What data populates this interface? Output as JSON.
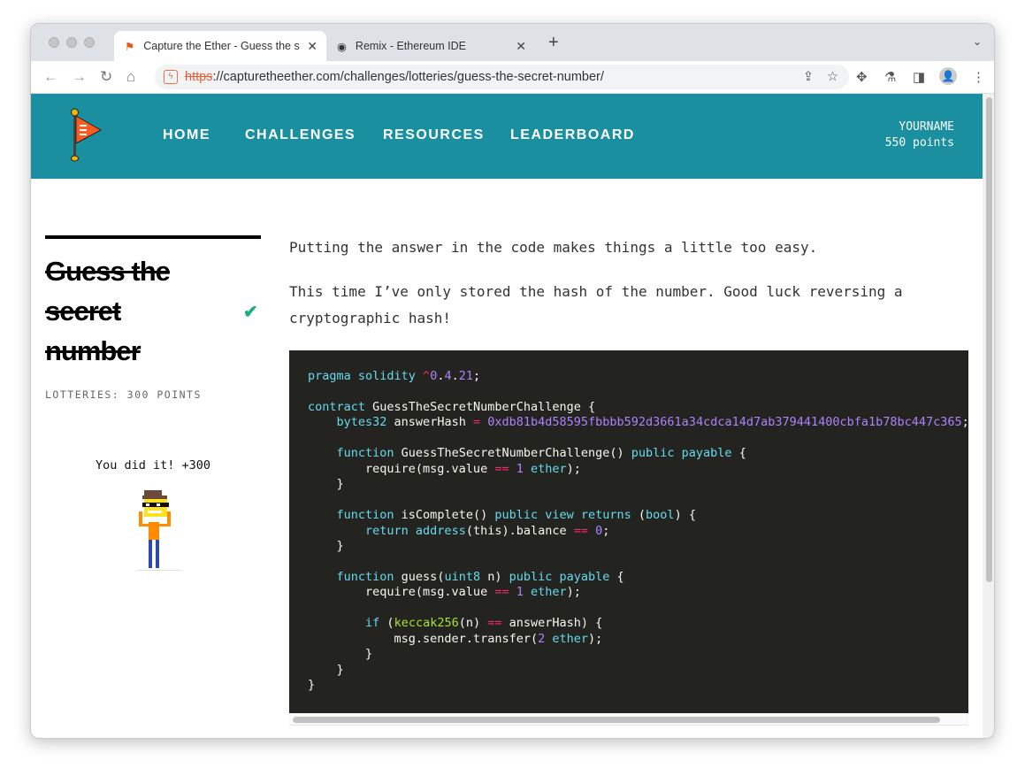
{
  "browser": {
    "tabs": [
      {
        "title": "Capture the Ether - Guess the s"
      },
      {
        "title": "Remix - Ethereum IDE"
      }
    ],
    "url_scheme": "https",
    "url_rest": "://capturetheether.com/challenges/lotteries/guess-the-secret-number/"
  },
  "header": {
    "menu": [
      "HOME",
      "CHALLENGES",
      "RESOURCES",
      "LEADERBOARD"
    ],
    "username": "YOURNAME",
    "points": "550 points"
  },
  "challenge": {
    "title": "Guess the secret number",
    "category": "LOTTERIES: 300 POINTS",
    "success": "You did it! +300"
  },
  "description": [
    "Putting the answer in the code makes things a little too easy.",
    "This time I’ve only stored the hash of the number. Good luck reversing a cryptographic hash!"
  ],
  "code": [
    [
      [
        "k",
        "pragma solidity "
      ],
      [
        "o",
        "^"
      ],
      [
        "n",
        "0"
      ],
      [
        "",
        "."
      ],
      [
        "n",
        "4"
      ],
      [
        "",
        "."
      ],
      [
        "n",
        "21"
      ],
      [
        "",
        ";"
      ]
    ],
    [],
    [
      [
        "k",
        "contract"
      ],
      [
        "",
        " GuessTheSecretNumberChallenge {"
      ]
    ],
    [
      [
        "",
        "    "
      ],
      [
        "k",
        "bytes32"
      ],
      [
        "",
        " answerHash "
      ],
      [
        "o",
        "="
      ],
      [
        "n",
        " 0xdb81b4d58595fbbbb592d3661a34cdca14d7ab379441400cbfa1b78bc447c365"
      ],
      [
        "",
        ";"
      ]
    ],
    [],
    [
      [
        "",
        "    "
      ],
      [
        "k",
        "function"
      ],
      [
        "",
        " GuessTheSecretNumberChallenge() "
      ],
      [
        "k",
        "public payable"
      ],
      [
        "",
        " {"
      ]
    ],
    [
      [
        "",
        "        require(msg.value "
      ],
      [
        "o",
        "=="
      ],
      [
        "n",
        " 1"
      ],
      [
        "k",
        " ether"
      ],
      [
        "",
        ");"
      ]
    ],
    [
      [
        "",
        "    }"
      ]
    ],
    [],
    [
      [
        "",
        "    "
      ],
      [
        "k",
        "function"
      ],
      [
        "",
        " isComplete() "
      ],
      [
        "k",
        "public view returns"
      ],
      [
        "",
        " ("
      ],
      [
        "k",
        "bool"
      ],
      [
        "",
        ") {"
      ]
    ],
    [
      [
        "",
        "        "
      ],
      [
        "k",
        "return address"
      ],
      [
        "",
        "(this).balance "
      ],
      [
        "o",
        "=="
      ],
      [
        "n",
        " 0"
      ],
      [
        "",
        ";"
      ]
    ],
    [
      [
        "",
        "    }"
      ]
    ],
    [],
    [
      [
        "",
        "    "
      ],
      [
        "k",
        "function"
      ],
      [
        "",
        " guess("
      ],
      [
        "k",
        "uint8"
      ],
      [
        "",
        " n) "
      ],
      [
        "k",
        "public payable"
      ],
      [
        "",
        " {"
      ]
    ],
    [
      [
        "",
        "        require(msg.value "
      ],
      [
        "o",
        "=="
      ],
      [
        "n",
        " 1"
      ],
      [
        "k",
        " ether"
      ],
      [
        "",
        ");"
      ]
    ],
    [],
    [
      [
        "",
        "        "
      ],
      [
        "k",
        "if"
      ],
      [
        "",
        " ("
      ],
      [
        "f",
        "keccak256"
      ],
      [
        "",
        "(n) "
      ],
      [
        "o",
        "=="
      ],
      [
        "",
        " answerHash) {"
      ]
    ],
    [
      [
        "",
        "            msg.sender.transfer("
      ],
      [
        "n",
        "2"
      ],
      [
        "k",
        " ether"
      ],
      [
        "",
        ");"
      ]
    ],
    [
      [
        "",
        "        }"
      ]
    ],
    [
      [
        "",
        "    }"
      ]
    ],
    [
      [
        "",
        "}"
      ]
    ]
  ]
}
